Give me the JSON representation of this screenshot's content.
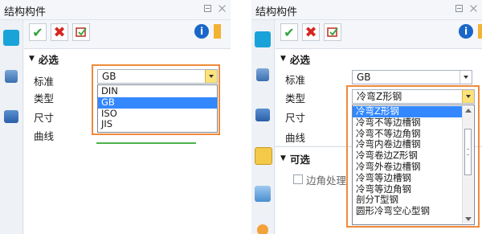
{
  "left_panel": {
    "title": "结构构件",
    "section_required": "必选",
    "fields": {
      "standard_label": "标准",
      "type_label": "类型",
      "size_label": "尺寸",
      "curve_label": "曲线"
    },
    "standard_value": "GB",
    "standard_options": [
      "DIN",
      "GB",
      "ISO",
      "JIS"
    ],
    "selected_option": "GB"
  },
  "right_panel": {
    "title": "结构构件",
    "section_required": "必选",
    "section_optional": "可选",
    "fields": {
      "standard_label": "标准",
      "type_label": "类型",
      "size_label": "尺寸",
      "curve_label": "曲线"
    },
    "standard_value": "GB",
    "type_value": "冷弯Z形钢",
    "type_options": [
      "冷弯Z形钢",
      "冷弯不等边槽钢",
      "冷弯不等边角钢",
      "冷弯内卷边槽钢",
      "冷弯卷边Z形钢",
      "冷弯外卷边槽钢",
      "冷弯等边槽钢",
      "冷弯等边角钢",
      "剖分T型钢",
      "圆形冷弯空心型钢"
    ],
    "optional_item": "边角处理"
  },
  "toolbar": {
    "ok_glyph": "✔",
    "cancel_glyph": "✖",
    "info_glyph": "i"
  },
  "colors": {
    "accent_orange": "#ef8a3a",
    "selection_blue": "#3388ff"
  }
}
